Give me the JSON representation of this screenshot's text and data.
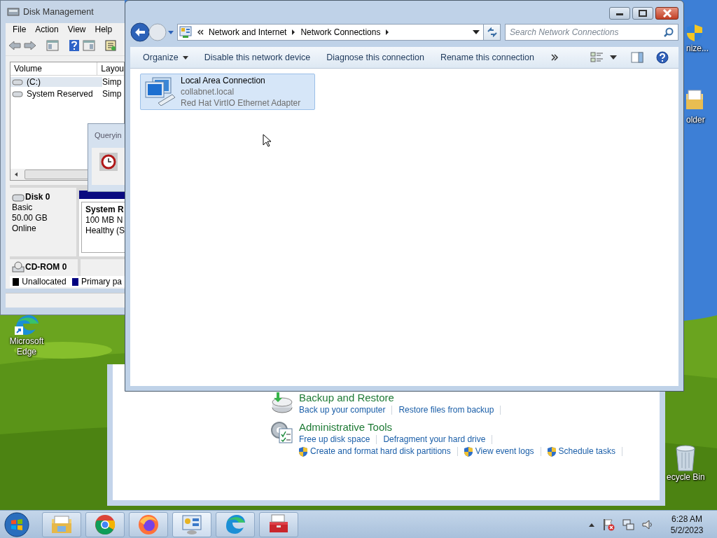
{
  "desktop": {
    "icons": [
      {
        "kind": "shield",
        "label": "nize..."
      },
      {
        "kind": "folder",
        "label": "older"
      },
      {
        "kind": "edge",
        "label": "Microsoft Edge"
      },
      {
        "kind": "bin",
        "label": "ecycle Bin"
      }
    ]
  },
  "disk_management": {
    "title": "Disk Management",
    "menu": [
      "File",
      "Action",
      "View",
      "Help"
    ],
    "columns": [
      "Volume",
      "Layou"
    ],
    "volumes": [
      {
        "name": "(C:)",
        "layout": "Simp",
        "selected": true
      },
      {
        "name": "System Reserved",
        "layout": "Simp",
        "selected": false
      }
    ],
    "disks": [
      {
        "kind": "disk",
        "name": "Disk 0",
        "lines": [
          "Basic",
          "50.00 GB",
          "Online"
        ],
        "partition": {
          "name": "System R",
          "lines": [
            "100 MB N",
            "Healthy (S"
          ]
        }
      },
      {
        "kind": "cdrom",
        "name": "CD-ROM 0"
      }
    ],
    "legend": [
      {
        "label": "Unallocated",
        "color": "#000000"
      },
      {
        "label": "Primary pa",
        "color": "#000080"
      }
    ]
  },
  "querying_dialog": {
    "title": "Queryin"
  },
  "network_window": {
    "breadcrumb": [
      "Network and Internet",
      "Network Connections"
    ],
    "search": {
      "placeholder": "Search Network Connections"
    },
    "commands": [
      {
        "label": "Organize",
        "dropdown": true
      },
      {
        "label": "Disable this network device",
        "dropdown": false
      },
      {
        "label": "Diagnose this connection",
        "dropdown": false
      },
      {
        "label": "Rename this connection",
        "dropdown": false
      }
    ],
    "connections": [
      {
        "name": "Local Area Connection",
        "network": "collabnet.local",
        "adapter": "Red Hat VirtIO Ethernet Adapter",
        "selected": true
      }
    ]
  },
  "control_panel": {
    "sections": [
      {
        "kind": "backup",
        "title": "Backup and Restore",
        "link_rows": [
          [
            {
              "text": "Back up your computer",
              "shield": false
            },
            {
              "text": "Restore files from backup",
              "shield": false
            }
          ]
        ]
      },
      {
        "kind": "admin",
        "title": "Administrative Tools",
        "link_rows": [
          [
            {
              "text": "Free up disk space",
              "shield": false
            },
            {
              "text": "Defragment your hard drive",
              "shield": false
            }
          ],
          [
            {
              "text": "Create and format hard disk partitions",
              "shield": true
            },
            {
              "text": "View event logs",
              "shield": true
            },
            {
              "text": "Schedule tasks",
              "shield": true
            }
          ]
        ]
      }
    ]
  },
  "taskbar": {
    "clock": {
      "time": "6:28 AM",
      "date": "5/2/2023"
    }
  }
}
